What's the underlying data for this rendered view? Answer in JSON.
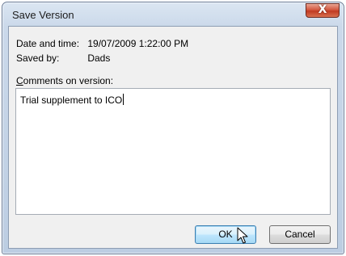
{
  "window": {
    "title": "Save Version",
    "close_glyph": "X"
  },
  "info": {
    "date_label": "Date and time:",
    "date_value": "19/07/2009 1:22:00 PM",
    "saved_by_label": "Saved by:",
    "saved_by_value": "Dads"
  },
  "comments": {
    "label_accel": "C",
    "label_rest": "omments on version:",
    "value": "Trial supplement to ICO"
  },
  "buttons": {
    "ok": "OK",
    "cancel": "Cancel"
  },
  "icons": {
    "close": "close-icon",
    "cursor": "mouse-pointer-icon"
  }
}
